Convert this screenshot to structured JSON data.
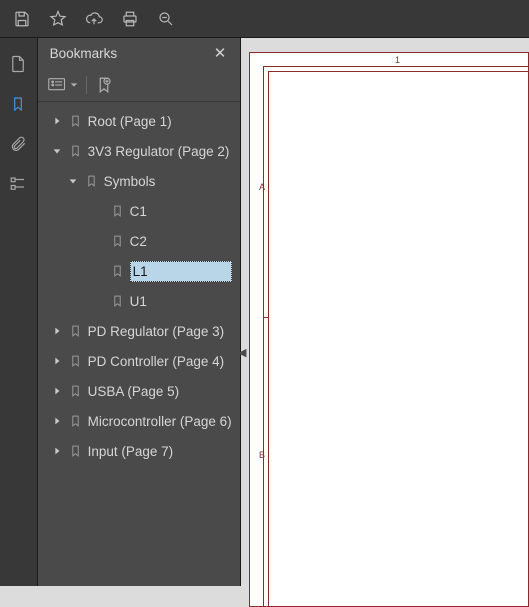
{
  "toolbar": {
    "icons": [
      "save-icon",
      "star-icon",
      "cloud-upload-icon",
      "print-icon",
      "zoom-icon"
    ]
  },
  "sidebar": {
    "icons": [
      "document-icon",
      "bookmark-icon",
      "attachment-icon",
      "outline-icon"
    ],
    "activeIndex": 1
  },
  "panel": {
    "title": "Bookmarks",
    "close": "✕"
  },
  "bookmarks": {
    "items": [
      {
        "label": "Root (Page 1)",
        "depth": 0,
        "expanded": false,
        "hasChildren": true
      },
      {
        "label": "3V3 Regulator (Page 2)",
        "depth": 0,
        "expanded": true,
        "hasChildren": true
      },
      {
        "label": "Symbols",
        "depth": 1,
        "expanded": true,
        "hasChildren": true
      },
      {
        "label": "C1",
        "depth": 2,
        "expanded": false,
        "hasChildren": false
      },
      {
        "label": "C2",
        "depth": 2,
        "expanded": false,
        "hasChildren": false
      },
      {
        "label": "L1",
        "depth": 2,
        "expanded": false,
        "hasChildren": false,
        "selected": true
      },
      {
        "label": "U1",
        "depth": 2,
        "expanded": false,
        "hasChildren": false
      },
      {
        "label": "PD Regulator (Page 3)",
        "depth": 0,
        "expanded": false,
        "hasChildren": true
      },
      {
        "label": "PD Controller (Page 4)",
        "depth": 0,
        "expanded": false,
        "hasChildren": true
      },
      {
        "label": "USBA (Page 5)",
        "depth": 0,
        "expanded": false,
        "hasChildren": true
      },
      {
        "label": "Microcontroller (Page 6)",
        "depth": 0,
        "expanded": false,
        "hasChildren": true
      },
      {
        "label": "Input (Page 7)",
        "depth": 0,
        "expanded": false,
        "hasChildren": true
      }
    ]
  },
  "page": {
    "col1": "1",
    "rowA": "A",
    "rowB": "B"
  }
}
